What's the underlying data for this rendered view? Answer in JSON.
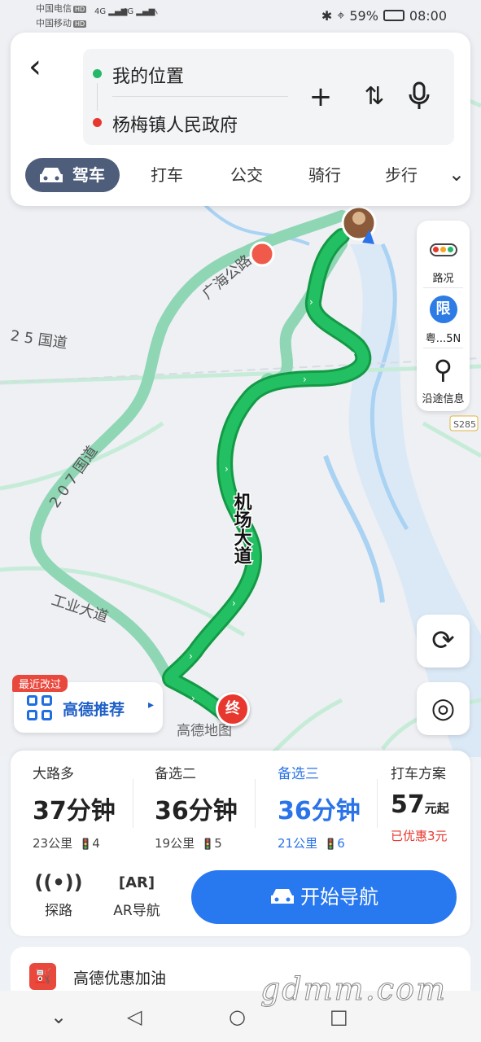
{
  "status_bar": {
    "carrier1": "中国电信",
    "carrier2": "中国移动",
    "hd": "HD",
    "signal": "4G",
    "battery": "59%",
    "time": "08:00"
  },
  "route": {
    "from": "我的位置",
    "to": "杨梅镇人民政府",
    "modes": [
      "驾车",
      "打车",
      "公交",
      "骑行",
      "步行"
    ]
  },
  "tools": {
    "traffic": "路况",
    "limit_badge": "限",
    "limit_text": "粤...5N",
    "along_info": "沿途信息"
  },
  "map": {
    "road_labels": {
      "guanghai": "广海公路",
      "g325": "2 5 国道",
      "g207": "2 0 7 国道",
      "airport": "机场大道",
      "industry": "工业大道",
      "s285": "S285"
    },
    "end_marker": "终",
    "map_watermark": "高德地图"
  },
  "recommend": {
    "tag": "最近改过",
    "label": "高德推荐"
  },
  "plans": [
    {
      "name": "大路多",
      "time": "37",
      "unit": "分钟",
      "info": "23公里",
      "lights": "4"
    },
    {
      "name": "备选二",
      "time": "36",
      "unit": "分钟",
      "info": "19公里",
      "lights": "5"
    },
    {
      "name": "备选三",
      "time": "36",
      "unit": "分钟",
      "info": "21公里",
      "lights": "6",
      "active": true
    },
    {
      "name": "打车方案",
      "time": "57",
      "unit": "元起",
      "info": "已优惠3元"
    }
  ],
  "actions": {
    "explore": "探路",
    "ar_nav": "AR导航",
    "start_nav": "开始导航"
  },
  "fuel": {
    "label": "高德优惠加油"
  },
  "watermark": "gdmm.com",
  "colors": {
    "route_green": "#1fb95a",
    "alt_route": "#8fd6b4",
    "accent_blue": "#2878f0",
    "end_red": "#e8372e"
  }
}
